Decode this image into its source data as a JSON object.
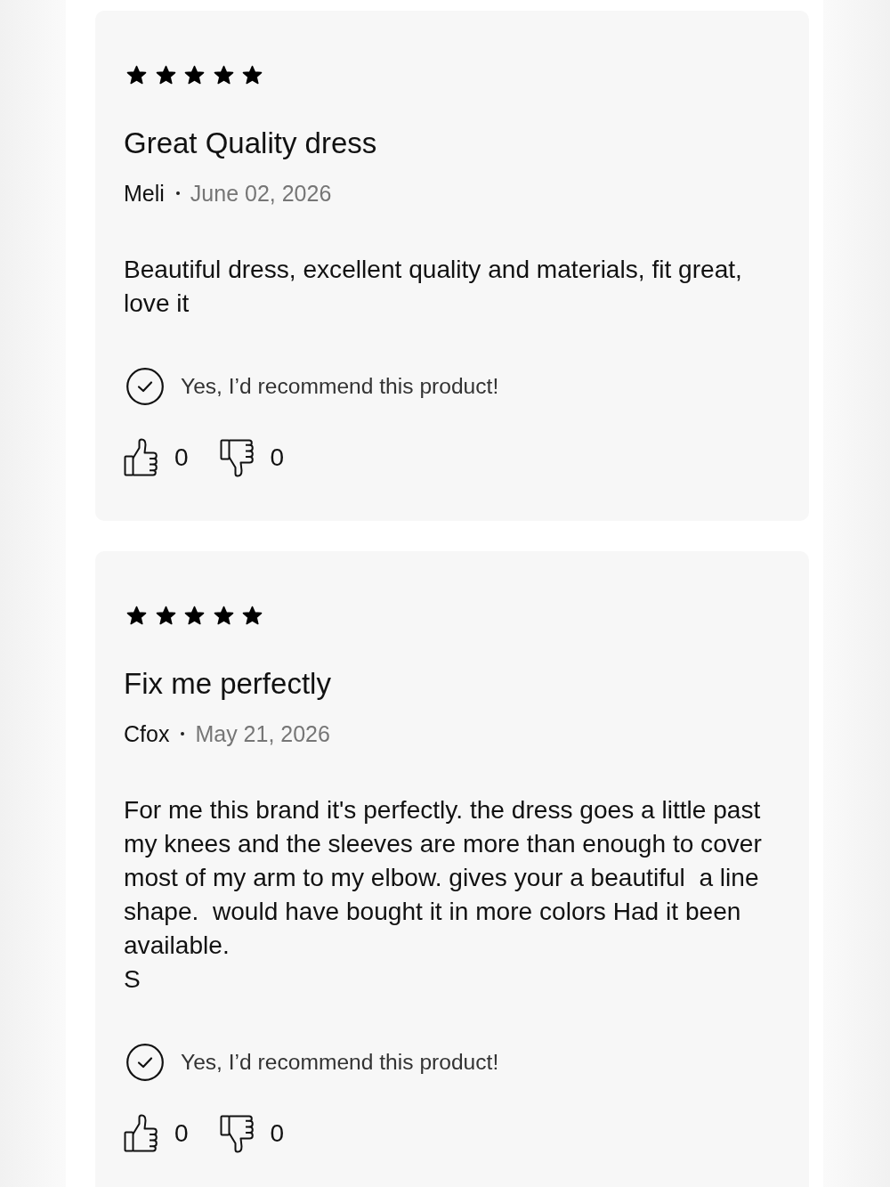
{
  "reviews": [
    {
      "stars": 5,
      "title": "Great Quality dress",
      "author": "Meli",
      "date": "June 02, 2026",
      "body": "Beautiful dress, excellent quality and materials, fit great, love it",
      "recommended": true,
      "recommend_text": "Yes, I’d recommend this product!",
      "helpful_count": "0",
      "unhelpful_count": "0"
    },
    {
      "stars": 5,
      "title": "Fix me perfectly",
      "author": "Cfox",
      "date": "May 21, 2026",
      "body": "For me this brand it's perfectly. the dress goes a little past my knees and the sleeves are more than enough to cover most of my arm to my elbow. gives your a beautiful  a line shape.  would have bought it in more colors Had it been available.\nS",
      "recommended": true,
      "recommend_text": "Yes, I’d recommend this product!",
      "helpful_count": "0",
      "unhelpful_count": "0"
    }
  ]
}
